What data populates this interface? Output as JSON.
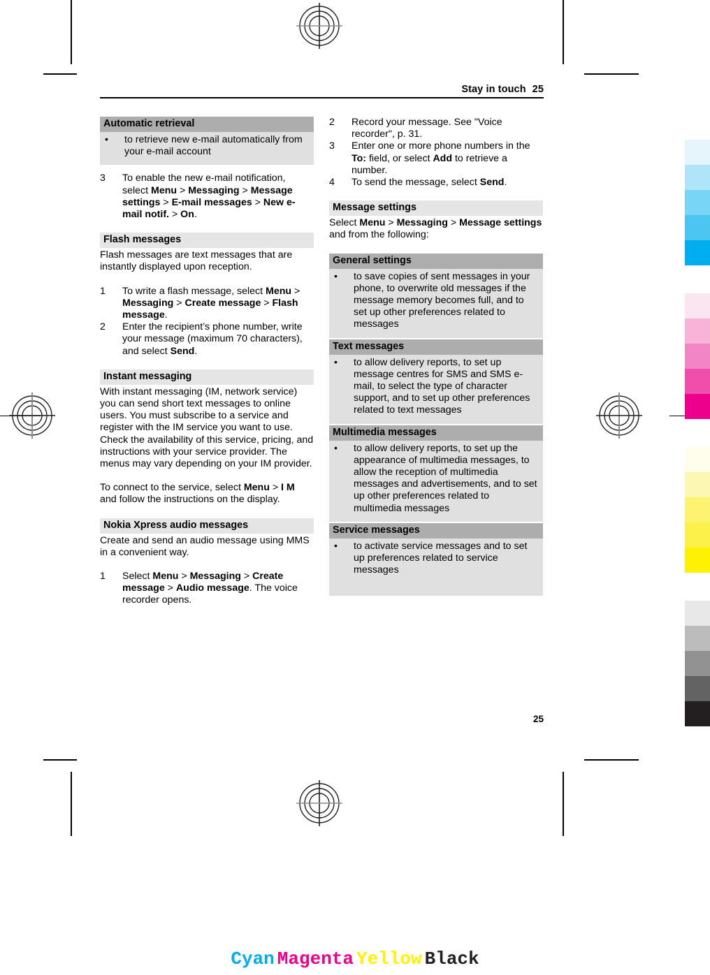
{
  "running_head": {
    "title": "Stay in touch",
    "page": "25"
  },
  "page_number": "25",
  "left_column": {
    "automatic_retrieval_box": {
      "header": "Automatic retrieval",
      "bullet": "•",
      "text": "to retrieve new e-mail automatically from your e-mail account"
    },
    "step3": {
      "num": "3",
      "t1": "To enable the new e-mail notification, select ",
      "b1": "Menu",
      "sep1": " > ",
      "b2": "Messaging",
      "sep2": " > ",
      "b3": "Message settings",
      "sep3": " > ",
      "b4": "E-mail messages",
      "sep4": " > ",
      "b5": "New e-mail notif.",
      "sep5": " > ",
      "b6": "On",
      "tail": "."
    },
    "flash_messages": {
      "heading": "Flash messages",
      "intro": "Flash messages are text messages that are instantly displayed upon reception.",
      "step1": {
        "num": "1",
        "t1": "To write a flash message, select ",
        "b1": "Menu",
        "sep1": " > ",
        "b2": "Messaging",
        "sep2": " > ",
        "b3": "Create message",
        "sep3": " > ",
        "b4": "Flash message",
        "tail": "."
      },
      "step2": {
        "num": "2",
        "t1": "Enter the recipient’s phone number, write your message (maximum 70 characters), and select ",
        "b1": "Send",
        "tail": "."
      }
    },
    "instant_messaging": {
      "heading": "Instant messaging",
      "para1": "With instant messaging (IM, network service) you can send short text messages to online users. You must subscribe to a service and register with the IM service you want to use. Check the availability of this service, pricing, and instructions with your service provider. The menus may vary depending on your IM provider.",
      "para2_t1": "To connect to the service, select ",
      "para2_b1": "Menu",
      "para2_sep": " > ",
      "para2_b2": "I M",
      "para2_tail": " and follow the instructions on the display."
    },
    "nokia_xpress": {
      "heading": "Nokia Xpress audio messages",
      "intro": "Create and send an audio message using MMS in a convenient way.",
      "step1": {
        "num": "1",
        "t1": "Select ",
        "b1": "Menu",
        "sep1": " > ",
        "b2": "Messaging",
        "sep2": " > ",
        "b3": "Create message",
        "sep3": " > ",
        "b4": "Audio message",
        "tail": ". The voice recorder opens."
      }
    }
  },
  "right_column": {
    "step2": {
      "num": "2",
      "text": "Record your message. See \"Voice recorder\", p. 31."
    },
    "step3": {
      "num": "3",
      "t1": "Enter one or more phone numbers in the ",
      "b1": "To:",
      "t2": " field, or select ",
      "b2": "Add",
      "tail": " to retrieve a number."
    },
    "step4": {
      "num": "4",
      "t1": "To send the message, select ",
      "b1": "Send",
      "tail": "."
    },
    "message_settings": {
      "heading": "Message settings",
      "t1": "Select ",
      "b1": "Menu",
      "sep1": " > ",
      "b2": "Messaging",
      "sep2": " > ",
      "b3": "Message settings",
      "tail": " and from the following:"
    },
    "boxes": [
      {
        "header": "General settings",
        "bullet": "•",
        "text": "to save copies of sent messages in your phone, to overwrite old messages if the message memory becomes full, and to set up other preferences related to messages"
      },
      {
        "header": "Text messages",
        "bullet": "•",
        "text": "to allow delivery reports, to set up message centres for SMS and SMS e-mail, to select the type of character support, and to set up other preferences related to text messages"
      },
      {
        "header": "Multimedia messages",
        "bullet": "•",
        "text": "to allow delivery reports, to set up the appearance of multimedia messages, to allow the reception of multimedia messages and advertisements, and to set up other preferences related to multimedia messages"
      },
      {
        "header": "Service messages",
        "bullet": "•",
        "text": "to activate service messages and to set up preferences related to service messages"
      }
    ]
  },
  "cmyk_legend": {
    "cyan": "Cyan",
    "magenta": "Magenta",
    "yellow": "Yellow",
    "black": "Black",
    "cyan_color": "#00AEEF",
    "magenta_color": "#EC008C",
    "yellow_color": "#FFF200",
    "black_color": "#231F20"
  },
  "color_bar": {
    "groups": [
      {
        "name": "cyan",
        "tints": [
          "#e6f5fc",
          "#b0e4f8",
          "#79d5f5",
          "#4cc5f0",
          "#00aeef"
        ]
      },
      {
        "name": "magenta",
        "tints": [
          "#fae6f1",
          "#f7b3d8",
          "#f285c3",
          "#ef4faa",
          "#ec008c"
        ]
      },
      {
        "name": "yellow",
        "tints": [
          "#fffdeb",
          "#fdf7b4",
          "#fcf471",
          "#fbf14a",
          "#fff200"
        ]
      },
      {
        "name": "black",
        "tints": [
          "#e8e8e8",
          "#bcbcbc",
          "#929292",
          "#636363",
          "#231f20"
        ]
      }
    ]
  }
}
